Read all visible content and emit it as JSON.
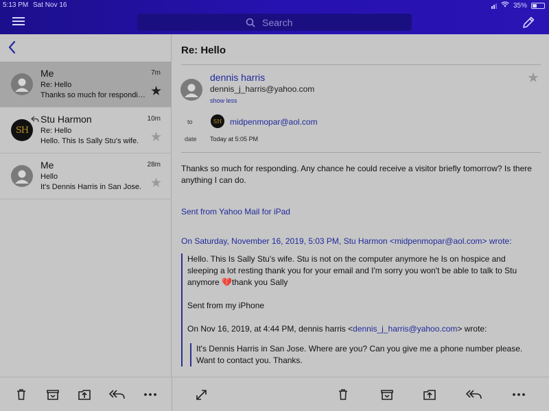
{
  "status": {
    "time": "5:13 PM",
    "date": "Sat Nov 16",
    "battery": "35%"
  },
  "header": {
    "search_placeholder": "Search"
  },
  "message_list": [
    {
      "sender": "Me",
      "time": "7m",
      "subject": "Re: Hello",
      "preview": "Thanks so much for responding.",
      "starred": true,
      "selected": true
    },
    {
      "sender": "Stu Harmon",
      "time": "10m",
      "subject": "Re: Hello",
      "preview": "Hello. This Is Sally Stu's wife.",
      "starred": false,
      "replied": true,
      "avatar_initials": "SH"
    },
    {
      "sender": "Me",
      "time": "28m",
      "subject": "Hello",
      "preview": "It's Dennis Harris in San Jose.",
      "starred": false
    }
  ],
  "message_view": {
    "title": "Re: Hello",
    "from_name": "dennis harris",
    "from_email": "dennis_j_harris@yahoo.com",
    "show_less": "show less",
    "to_label": "to",
    "to_avatar": "SH",
    "to_email": "midpenmopar@aol.com",
    "date_label": "date",
    "date_value": "Today at 5:05 PM",
    "body": "Thanks so much for responding.   Any chance he could receive a visitor briefly tomorrow?   Is there anything I can do.",
    "signature": "Sent from Yahoo Mail for iPad",
    "quote_header": "On Saturday, November 16, 2019, 5:03 PM, Stu Harmon <midpenmopar@aol.com> wrote:",
    "quote_body_1": "Hello. This  Is Sally Stu's wife. Stu is not on the computer anymore he Is on hospice and sleeping a lot resting thank you for your email and I'm sorry you won't be able to talk to Stu  anymore ",
    "quote_heart": "💔",
    "quote_body_2": "thank you Sally",
    "quote_signature": "Sent from my iPhone",
    "nested_header_prefix": "On Nov 16, 2019, at 4:44 PM, dennis harris <",
    "nested_header_email": "dennis_j_harris@yahoo.com",
    "nested_header_suffix": "> wrote:",
    "nested_body": "It's Dennis Harris in San Jose.   Where are you?   Can you give me a phone number please.   Want to contact you.  Thanks."
  },
  "icons": {
    "menu": "hamburger-menu-icon",
    "search": "search-icon",
    "compose": "compose-pencil-icon",
    "back": "chevron-left-icon",
    "delete": "trash-icon",
    "archive": "archive-icon",
    "move": "move-to-folder-icon",
    "reply_all": "reply-all-icon",
    "more": "more-dots-icon",
    "expand": "expand-icon"
  }
}
